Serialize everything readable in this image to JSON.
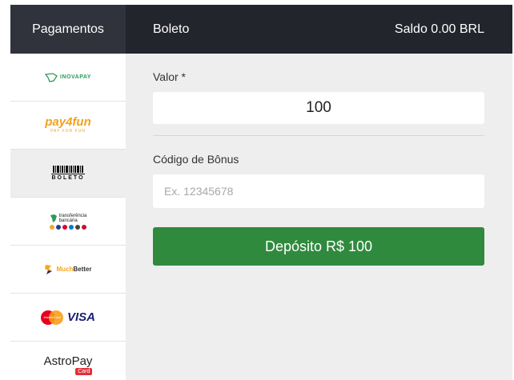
{
  "header": {
    "payments_tab": "Pagamentos",
    "method_title": "Boleto",
    "balance": "Saldo 0.00 BRL"
  },
  "sidebar": {
    "items": [
      {
        "id": "inovapay",
        "label": "INOVAPAY"
      },
      {
        "id": "payfun",
        "label": "pay4fun",
        "sublabel": "PAY FOR FUN"
      },
      {
        "id": "boleto",
        "label": "BOLETO",
        "active": true
      },
      {
        "id": "transferencia",
        "label_line1": "transferência",
        "label_line2": "bancária"
      },
      {
        "id": "muchbetter",
        "label_a": "Much",
        "label_b": "Better"
      },
      {
        "id": "visa-mastercard",
        "mc_label": "MasterCard",
        "visa_label": "VISA"
      },
      {
        "id": "astropay",
        "label": "AstroPay",
        "card": "Card"
      }
    ]
  },
  "form": {
    "amount_label": "Valor *",
    "amount_value": "100",
    "bonus_label": "Código de Bônus",
    "bonus_placeholder": "Ex. 12345678",
    "bonus_value": "",
    "deposit_button": "Depósito R$ 100"
  },
  "colors": {
    "header_bg": "#23252c",
    "active_tab_bg": "#30333b",
    "content_bg": "#eeeeee",
    "deposit_button": "#2f8a3e"
  }
}
